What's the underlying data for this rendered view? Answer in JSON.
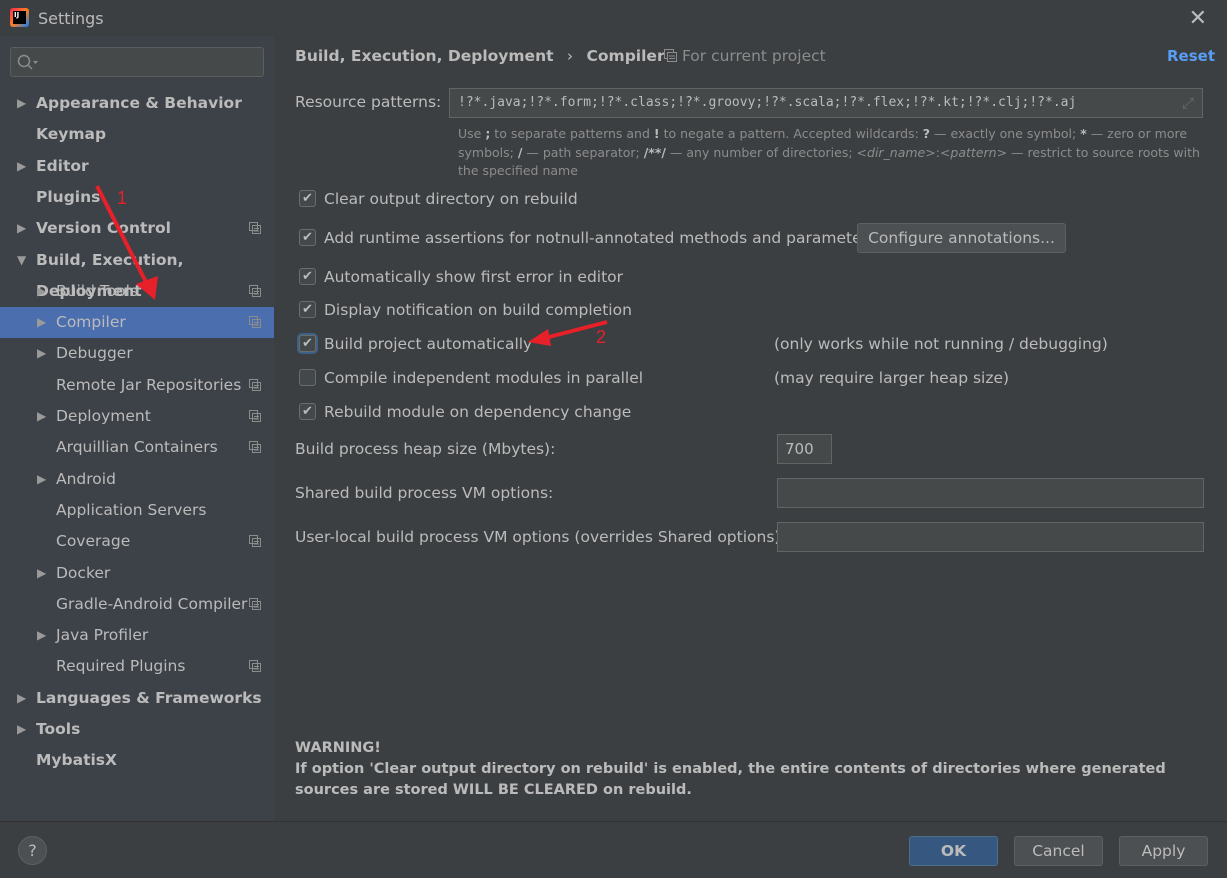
{
  "window": {
    "title": "Settings",
    "app_icon": "intellij-idea-icon",
    "close_icon": "close-icon"
  },
  "sidebar": {
    "search_placeholder": "",
    "items": [
      {
        "label": "Appearance & Behavior",
        "level": 0,
        "bold": true,
        "expandable": true,
        "expanded": false,
        "project": false
      },
      {
        "label": "Keymap",
        "level": 0,
        "bold": true,
        "expandable": false,
        "project": false
      },
      {
        "label": "Editor",
        "level": 0,
        "bold": true,
        "expandable": true,
        "expanded": false,
        "project": false
      },
      {
        "label": "Plugins",
        "level": 0,
        "bold": true,
        "expandable": false,
        "project": false
      },
      {
        "label": "Version Control",
        "level": 0,
        "bold": true,
        "expandable": true,
        "expanded": false,
        "project": true
      },
      {
        "label": "Build, Execution, Deployment",
        "level": 0,
        "bold": true,
        "expandable": true,
        "expanded": true,
        "project": false
      },
      {
        "label": "Build Tools",
        "level": 1,
        "expandable": true,
        "expanded": false,
        "project": true
      },
      {
        "label": "Compiler",
        "level": 1,
        "expandable": true,
        "expanded": false,
        "project": true,
        "selected": true
      },
      {
        "label": "Debugger",
        "level": 1,
        "expandable": true,
        "expanded": false,
        "project": false
      },
      {
        "label": "Remote Jar Repositories",
        "level": 1,
        "expandable": false,
        "project": true
      },
      {
        "label": "Deployment",
        "level": 1,
        "expandable": true,
        "expanded": false,
        "project": true
      },
      {
        "label": "Arquillian Containers",
        "level": 1,
        "expandable": false,
        "project": true
      },
      {
        "label": "Android",
        "level": 1,
        "expandable": true,
        "expanded": false,
        "project": false
      },
      {
        "label": "Application Servers",
        "level": 1,
        "expandable": false,
        "project": false
      },
      {
        "label": "Coverage",
        "level": 1,
        "expandable": false,
        "project": true
      },
      {
        "label": "Docker",
        "level": 1,
        "expandable": true,
        "expanded": false,
        "project": false
      },
      {
        "label": "Gradle-Android Compiler",
        "level": 1,
        "expandable": false,
        "project": true
      },
      {
        "label": "Java Profiler",
        "level": 1,
        "expandable": true,
        "expanded": false,
        "project": false
      },
      {
        "label": "Required Plugins",
        "level": 1,
        "expandable": false,
        "project": true
      },
      {
        "label": "Languages & Frameworks",
        "level": 0,
        "bold": true,
        "expandable": true,
        "expanded": false,
        "project": false
      },
      {
        "label": "Tools",
        "level": 0,
        "bold": true,
        "expandable": true,
        "expanded": false,
        "project": false
      },
      {
        "label": "MybatisX",
        "level": 0,
        "bold": true,
        "expandable": false,
        "project": false
      }
    ]
  },
  "header": {
    "breadcrumb": [
      "Build, Execution, Deployment",
      "Compiler"
    ],
    "separator": "›",
    "scope": "For current project",
    "reset": "Reset"
  },
  "resource": {
    "label": "Resource patterns:",
    "value": "!?*.java;!?*.form;!?*.class;!?*.groovy;!?*.scala;!?*.flex;!?*.kt;!?*.clj;!?*.aj",
    "hint": {
      "p1": "Use ",
      "s1": ";",
      "p2": " to separate patterns and ",
      "s2": "!",
      "p3": " to negate a pattern. Accepted wildcards: ",
      "s3": "?",
      "p4": " — exactly one symbol; ",
      "s4": "*",
      "p5": " — zero or more symbols; ",
      "s5": "/",
      "p6": " — path separator; ",
      "s6": "/**/",
      "p7": " — any number of directories; ",
      "i1": "<dir_name>",
      "p8": ":",
      "i2": "<pattern>",
      "p9": " — restrict to source roots with the specified name"
    }
  },
  "options": [
    {
      "label": "Clear output directory on rebuild",
      "checked": true
    },
    {
      "label": "Add runtime assertions for notnull-annotated methods and parameters",
      "checked": true
    },
    {
      "label": "Automatically show first error in editor",
      "checked": true
    },
    {
      "label": "Display notification on build completion",
      "checked": true
    },
    {
      "label": "Build project automatically",
      "checked": true,
      "focused": true,
      "note": "(only works while not running / debugging)"
    },
    {
      "label": "Compile independent modules in parallel",
      "checked": false,
      "note": "(may require larger heap size)"
    },
    {
      "label": "Rebuild module on dependency change",
      "checked": true
    }
  ],
  "configure_button": "Configure annotations...",
  "heap": {
    "label": "Build process heap size (Mbytes):",
    "value": "700"
  },
  "shared_vm": {
    "label": "Shared build process VM options:",
    "value": ""
  },
  "user_vm": {
    "label": "User-local build process VM options (overrides Shared options):",
    "value": ""
  },
  "warning": {
    "title": "WARNING!",
    "text": "If option 'Clear output directory on rebuild' is enabled, the entire contents of directories where generated sources are stored WILL BE CLEARED on rebuild."
  },
  "footer": {
    "help": "?",
    "ok": "OK",
    "cancel": "Cancel",
    "apply": "Apply"
  },
  "annotations": {
    "arrow1_label": "1",
    "arrow2_label": "2",
    "color": "#e8202a"
  },
  "colors": {
    "selection": "#4b6eaf",
    "link": "#589df6",
    "ok_button": "#365880"
  }
}
